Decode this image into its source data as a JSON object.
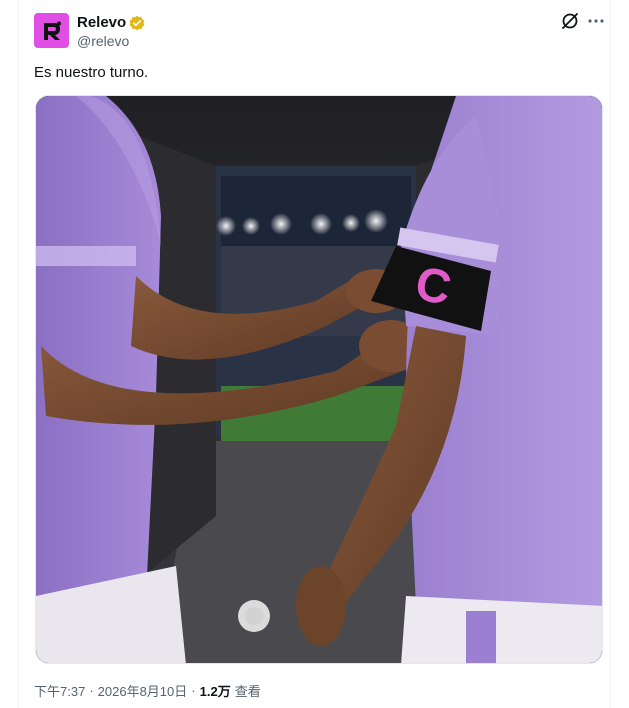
{
  "post": {
    "display_name": "Relevo",
    "handle": "@relevo",
    "text": "Es nuestro turno.",
    "verified_badge": "gold-check",
    "avatar_color": "#e04ee6"
  },
  "media": {
    "armband_letter": "C",
    "jersey_color": "#9b7fd0",
    "armband_color": "#111111",
    "letter_color": "#e05bc8"
  },
  "meta": {
    "time": "下午7:37",
    "separator": "·",
    "date": "2026年8月10日",
    "views_count": "1.2万",
    "views_label": "查看"
  },
  "icons": {
    "grok": "grok-icon",
    "more": "more-icon"
  }
}
